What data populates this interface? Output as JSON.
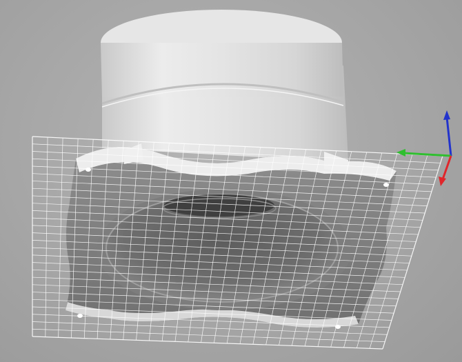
{
  "viewport": {
    "background_color": "#a9a9a9",
    "grid_color": "#ffffff"
  },
  "model": {
    "body_color": "#e2e2e2",
    "shade_color": "#6f6f6f"
  },
  "axes": {
    "x_color": "#e0262b",
    "y_color": "#2fbf2f",
    "z_color": "#2233cc"
  }
}
